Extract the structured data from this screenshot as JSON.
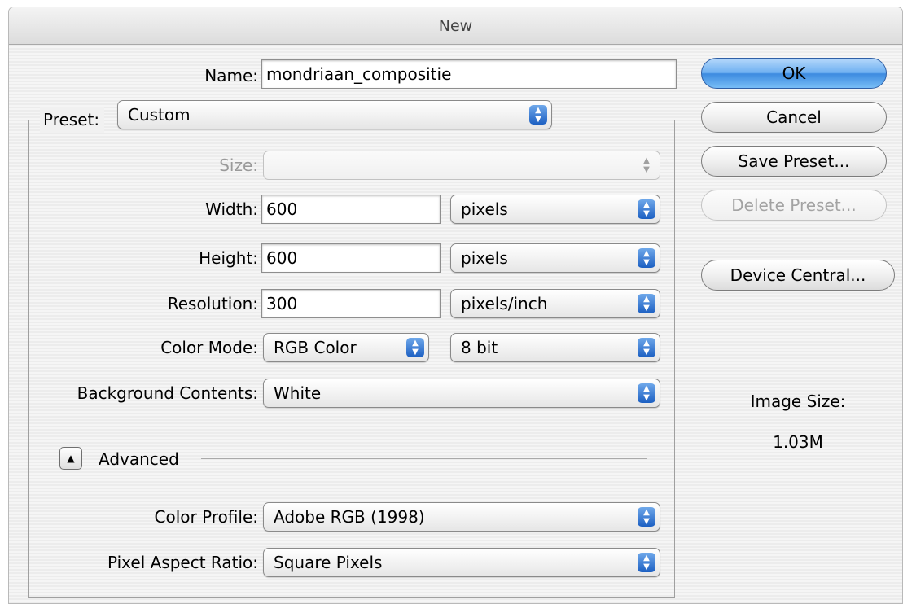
{
  "window": {
    "title": "New"
  },
  "form": {
    "name_label": "Name:",
    "name_value": "mondriaan_compositie",
    "preset_label": "Preset:",
    "preset_value": "Custom",
    "size_label": "Size:",
    "size_value": "",
    "width_label": "Width:",
    "width_value": "600",
    "width_unit": "pixels",
    "height_label": "Height:",
    "height_value": "600",
    "height_unit": "pixels",
    "resolution_label": "Resolution:",
    "resolution_value": "300",
    "resolution_unit": "pixels/inch",
    "color_mode_label": "Color Mode:",
    "color_mode_value": "RGB Color",
    "bit_depth_value": "8 bit",
    "background_label": "Background Contents:",
    "background_value": "White",
    "advanced_label": "Advanced",
    "color_profile_label": "Color Profile:",
    "color_profile_value": "Adobe RGB (1998)",
    "pixel_aspect_label": "Pixel Aspect Ratio:",
    "pixel_aspect_value": "Square Pixels"
  },
  "buttons": {
    "ok": "OK",
    "cancel": "Cancel",
    "save_preset": "Save Preset...",
    "delete_preset": "Delete Preset...",
    "device_central": "Device Central..."
  },
  "info": {
    "image_size_label": "Image Size:",
    "image_size_value": "1.03M"
  },
  "icons": {
    "popup_arrows": "up-down-arrows-icon",
    "disclosure": "disclosure-triangle-icon"
  },
  "colors": {
    "accent_blue": "#3d8be0",
    "default_button": "#6fb0f1"
  }
}
